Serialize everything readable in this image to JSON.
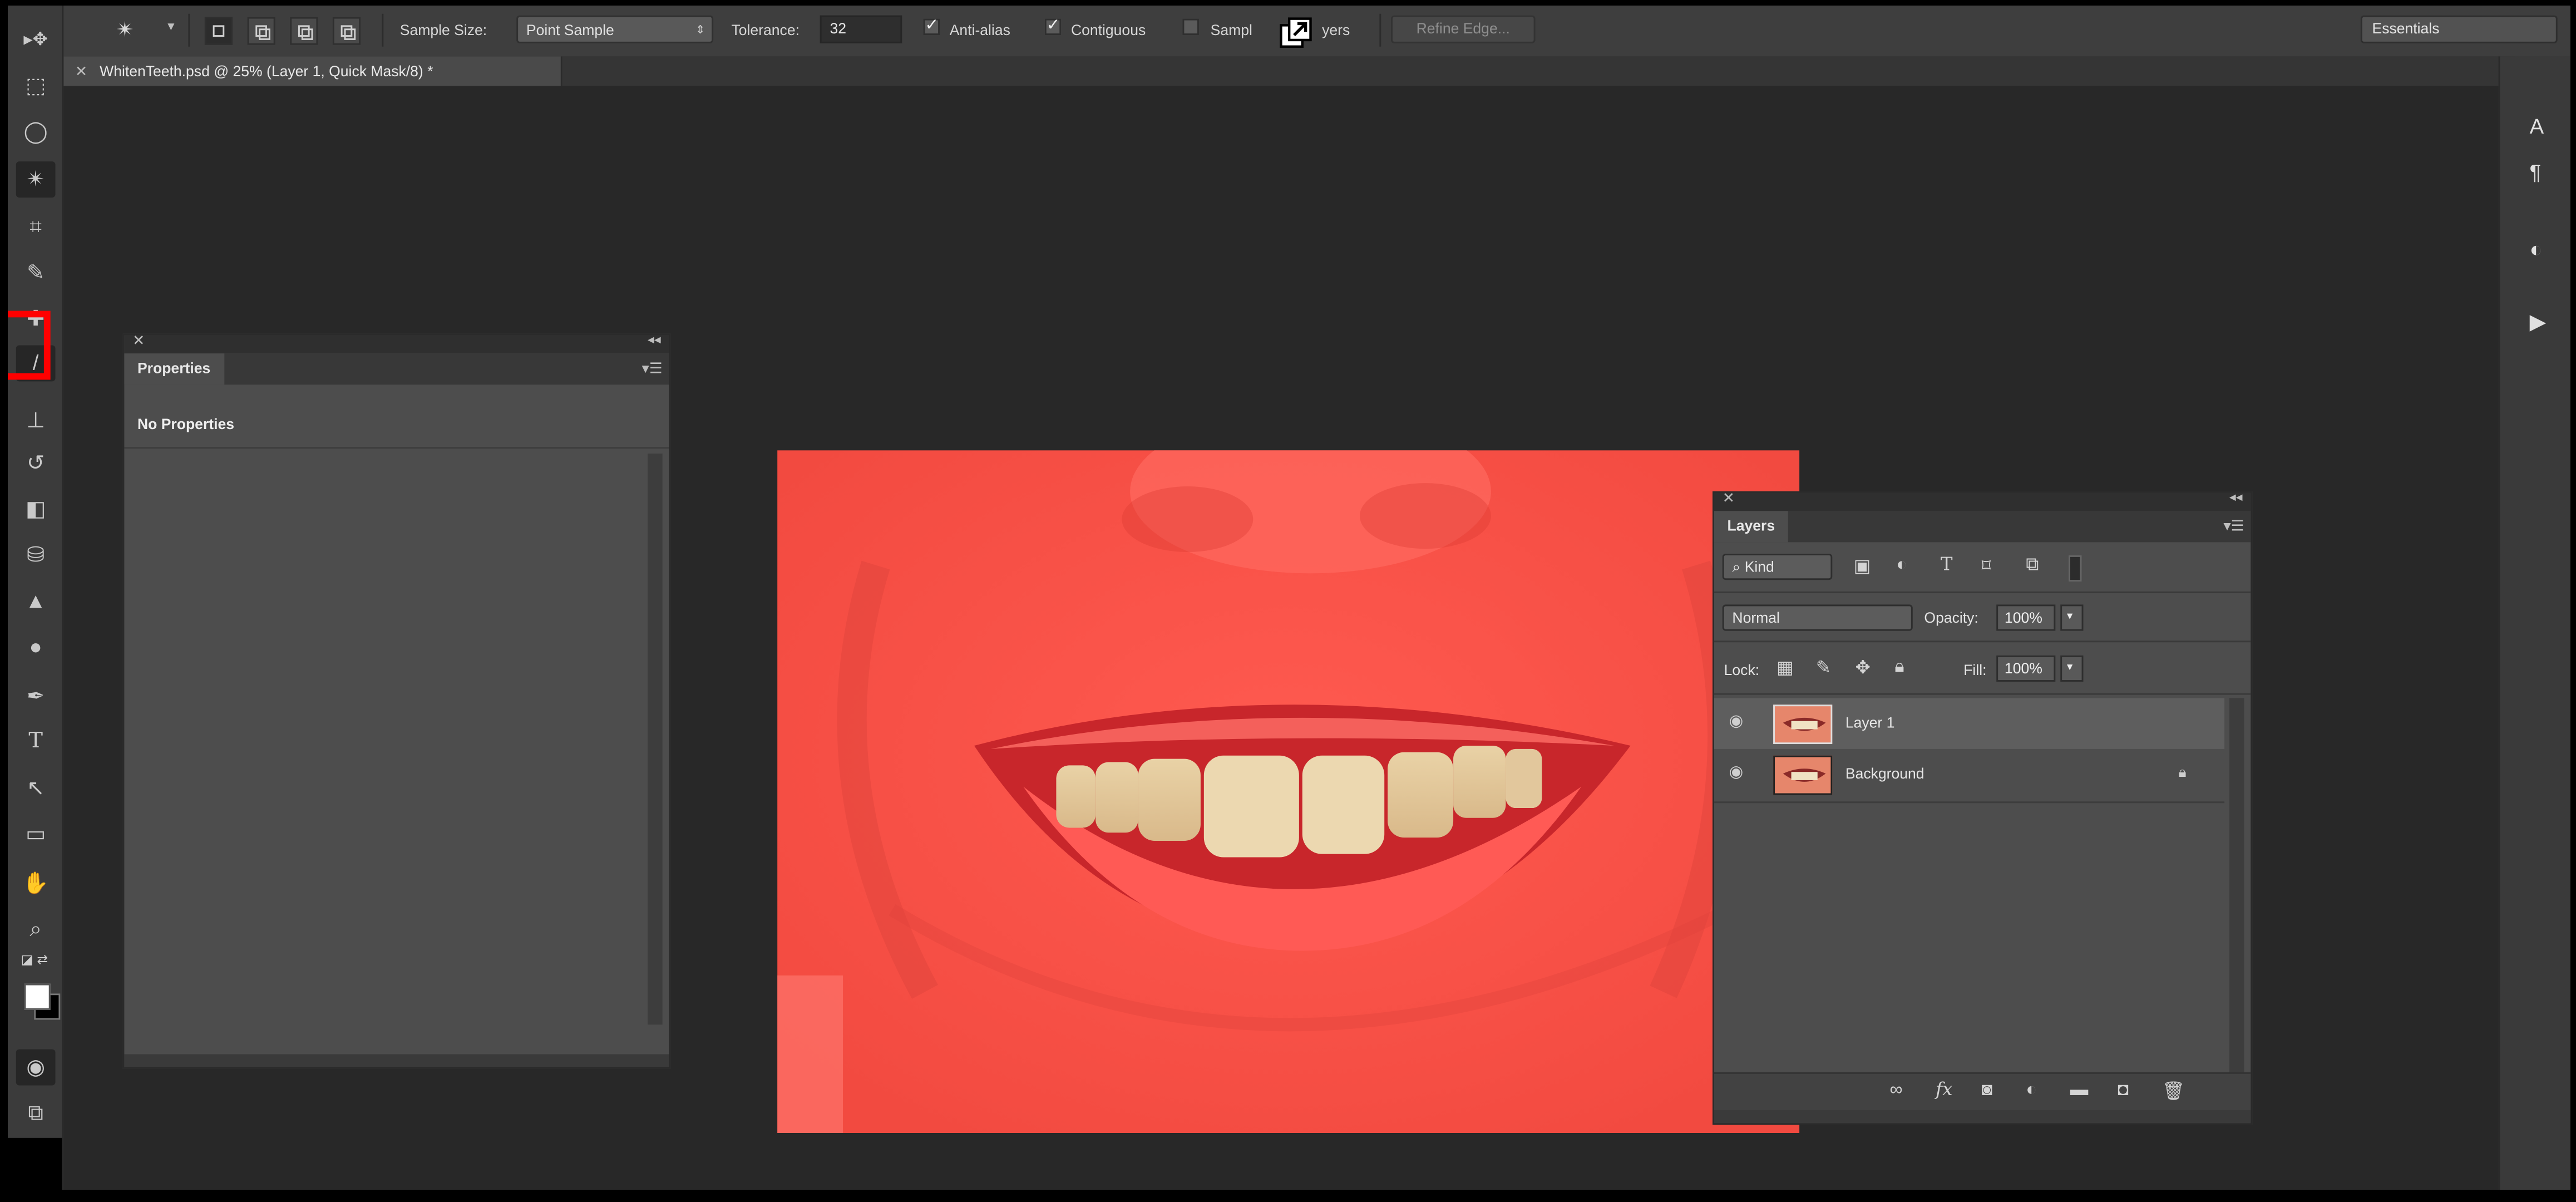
{
  "options_bar": {
    "sample_size_label": "Sample Size:",
    "sample_size_value": "Point Sample",
    "tolerance_label": "Tolerance:",
    "tolerance_value": "32",
    "anti_alias_label": "Anti-alias",
    "anti_alias_checked": true,
    "contiguous_label": "Contiguous",
    "contiguous_checked": true,
    "sample_all_layers_label": "Sample All Layers",
    "sample_all_layers_visible_a": "Sampl",
    "sample_all_layers_visible_b": "yers",
    "sample_all_layers_checked": false,
    "refine_edge_label": "Refine Edge...",
    "workspace_value": "Essentials"
  },
  "document_tab": {
    "title": "WhitenTeeth.psd @ 25% (Layer 1, Quick Mask/8) *"
  },
  "properties_panel": {
    "tab_label": "Properties",
    "content": "No Properties"
  },
  "layers_panel": {
    "tab_label": "Layers",
    "filter_kind": "Kind",
    "blend_mode": "Normal",
    "opacity_label": "Opacity:",
    "opacity_value": "100%",
    "lock_label": "Lock:",
    "fill_label": "Fill:",
    "fill_value": "100%",
    "layers": [
      {
        "name": "Layer 1",
        "selected": true,
        "locked": false
      },
      {
        "name": "Background",
        "selected": false,
        "locked": true
      }
    ]
  },
  "right_dock": {
    "buttons": [
      "character-icon",
      "paragraph-icon",
      "layer-comps-icon",
      "play-icon"
    ],
    "character_glyph": "A",
    "paragraph_glyph": "¶"
  },
  "colors": {
    "quick_mask_overlay": "#ff4b45",
    "highlight_box": "#ff0000",
    "panel_bg": "#4d4d4d",
    "app_bg": "#282828"
  }
}
